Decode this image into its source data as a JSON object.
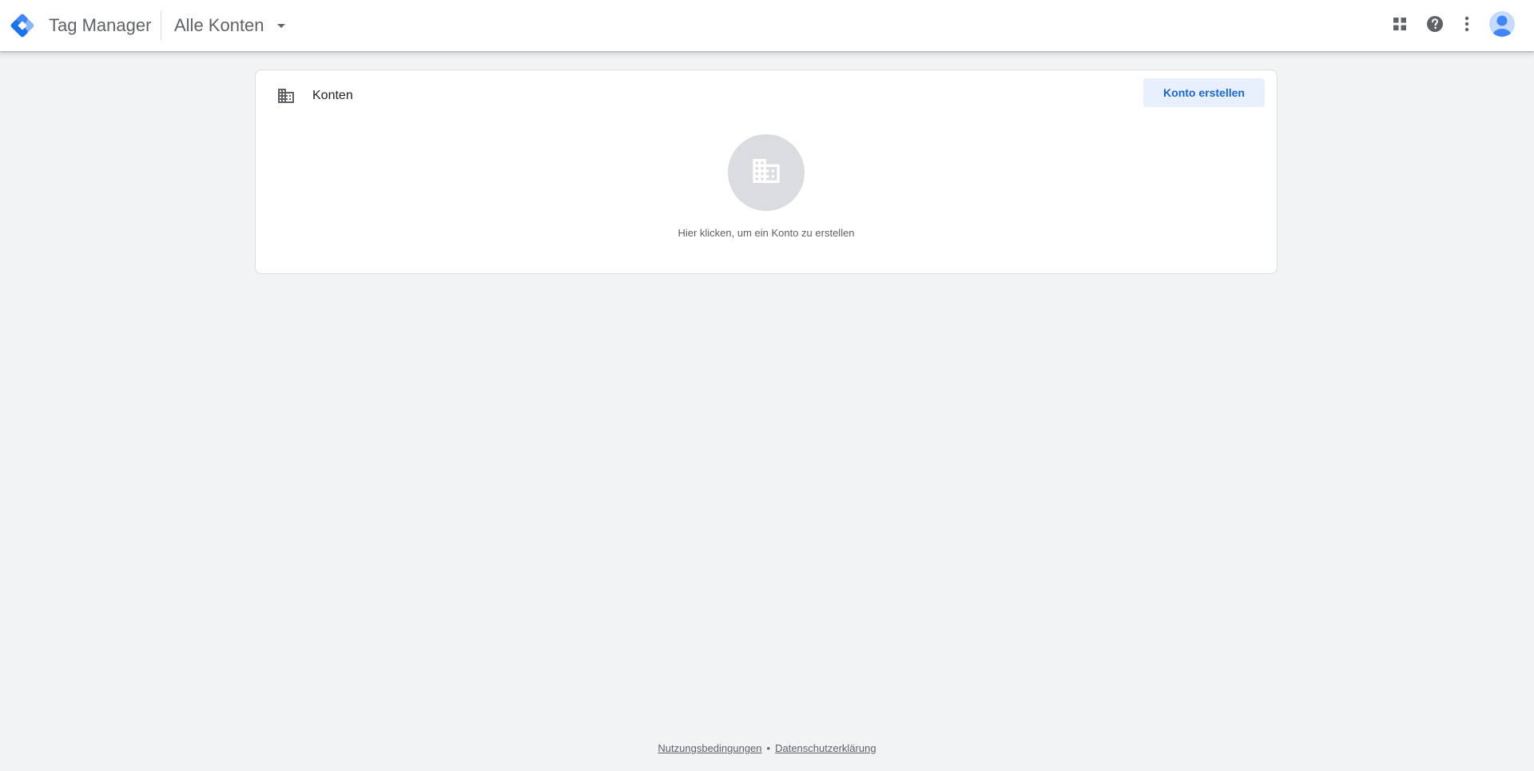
{
  "header": {
    "product_name": "Tag Manager",
    "account_picker_label": "Alle Konten",
    "icons": {
      "logo": "tag-manager-logo-icon",
      "apps": "apps-grid-icon",
      "help": "help-icon",
      "more": "more-vert-icon",
      "avatar": "account-avatar-icon"
    }
  },
  "accounts_card": {
    "title": "Konten",
    "create_button_label": "Konto erstellen",
    "empty_state_text": "Hier klicken, um ein Konto zu erstellen",
    "icons": {
      "header": "building-icon",
      "empty": "building-icon"
    }
  },
  "footer": {
    "terms_label": "Nutzungsbedingungen",
    "separator": "•",
    "privacy_label": "Datenschutzerklärung"
  },
  "colors": {
    "background": "#f1f3f4",
    "accent_button_bg": "#e8f0fe",
    "accent_button_text": "#1967d2",
    "avatar": "#4285f4"
  }
}
